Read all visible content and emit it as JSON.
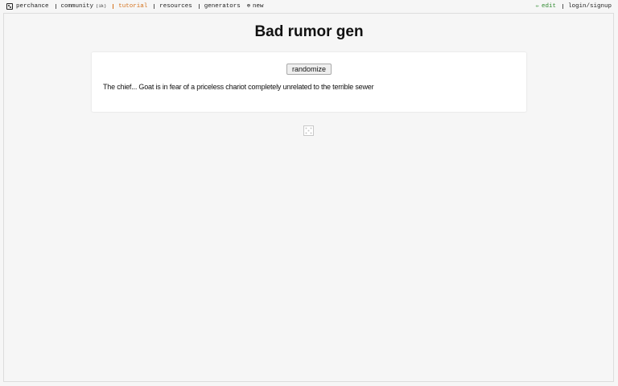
{
  "nav": {
    "brand": "perchance",
    "community": "community",
    "community_badge": "(1k)",
    "tutorial": "tutorial",
    "resources": "resources",
    "generators": "generators",
    "new": "new",
    "edit": "edit",
    "login": "login/signup"
  },
  "page": {
    "title": "Bad rumor gen",
    "button_label": "randomize",
    "output_text": "The chief... Goat is in fear of a priceless chariot completely unrelated to the terrible sewer"
  },
  "colors": {
    "tutorial": "#d4701a",
    "edit": "#2f8a2f",
    "background": "#f6f6f6"
  }
}
